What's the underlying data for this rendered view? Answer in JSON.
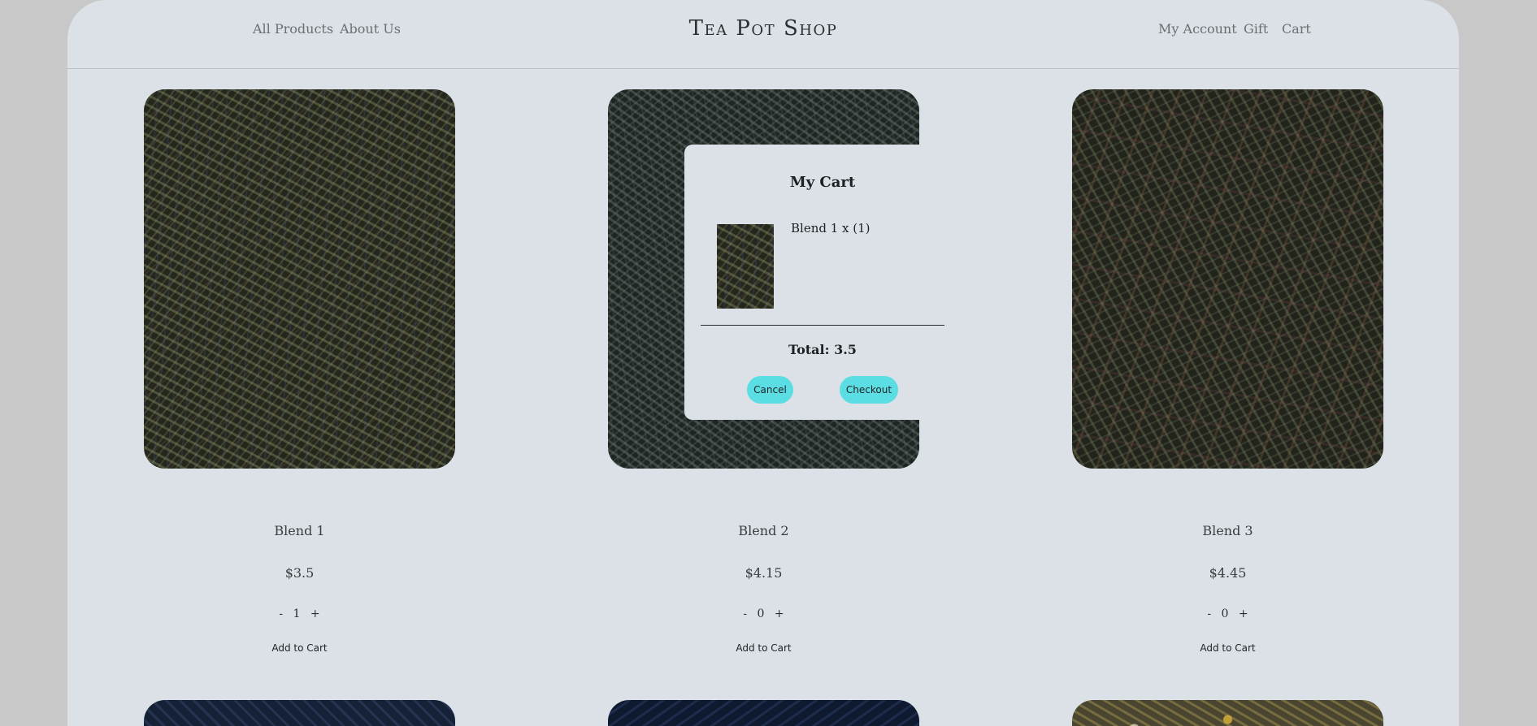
{
  "header": {
    "nav_left": [
      "All Products",
      "About Us"
    ],
    "brand": "Tea Pot Shop",
    "nav_right": [
      "My Account",
      "Gift",
      "Cart"
    ]
  },
  "products": [
    {
      "name": "Blend 1",
      "price": "$3.5",
      "qty": "1",
      "minus": "-",
      "plus": "+",
      "add_label": "Add to Cart"
    },
    {
      "name": "Blend 2",
      "price": "$4.15",
      "qty": "0",
      "minus": "-",
      "plus": "+",
      "add_label": "Add to Cart"
    },
    {
      "name": "Blend 3",
      "price": "$4.45",
      "qty": "0",
      "minus": "-",
      "plus": "+",
      "add_label": "Add to Cart"
    }
  ],
  "cart_modal": {
    "title": "My Cart",
    "items": [
      {
        "label": "Blend 1 x (1)"
      }
    ],
    "total": "Total: 3.5",
    "cancel_label": "Cancel",
    "checkout_label": "Checkout"
  },
  "colors": {
    "page_bg": "#dbe1e6",
    "outer_bg": "#c8c8c8",
    "button_accent": "#5bdde4"
  }
}
